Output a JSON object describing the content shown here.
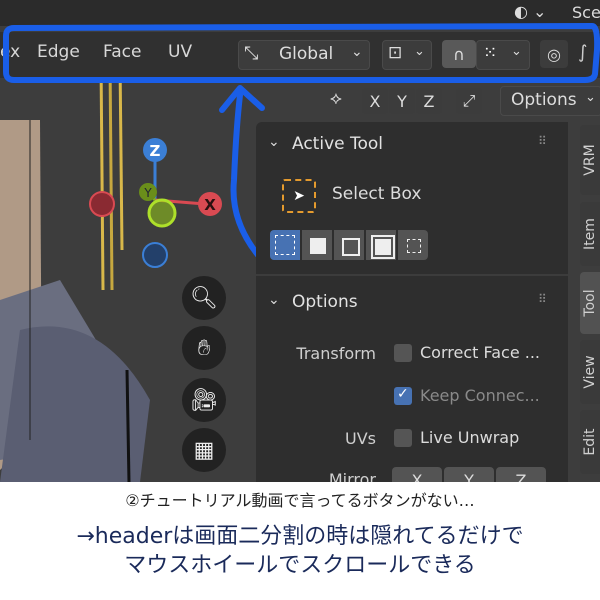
{
  "topbar": {
    "scene_text": "Sce"
  },
  "header": {
    "menu_cutoff": "ex",
    "menus": [
      "Edge",
      "Face",
      "UV"
    ],
    "transform_orientation": "Global"
  },
  "viewport_header": {
    "axes": [
      "X",
      "Y",
      "Z"
    ],
    "options_label": "Options"
  },
  "gizmo": {
    "z_label": "Z",
    "x_label": "X",
    "y_label": "Y"
  },
  "active_tool": {
    "title": "Active Tool",
    "tool_name": "Select Box"
  },
  "options": {
    "title": "Options",
    "transform_label": "Transform",
    "correct_face": "Correct Face ...",
    "keep_connected": "Keep Connec...",
    "uvs_label": "UVs",
    "live_unwrap": "Live Unwrap",
    "mirror_label": "Mirror",
    "mirror_axes": [
      "X",
      "Y",
      "Z"
    ]
  },
  "side_tabs": [
    "VRM",
    "Item",
    "Tool",
    "View",
    "Edit"
  ],
  "captions": {
    "line1": "②チュートリアル動画で言ってるボタンがない…",
    "line2": "→headerは画面二分割の時は隠れてるだけで",
    "line3": "マウスホイールでスクロールできる"
  },
  "colors": {
    "annotation": "#1a5ee8",
    "accent": "#4772b3"
  }
}
